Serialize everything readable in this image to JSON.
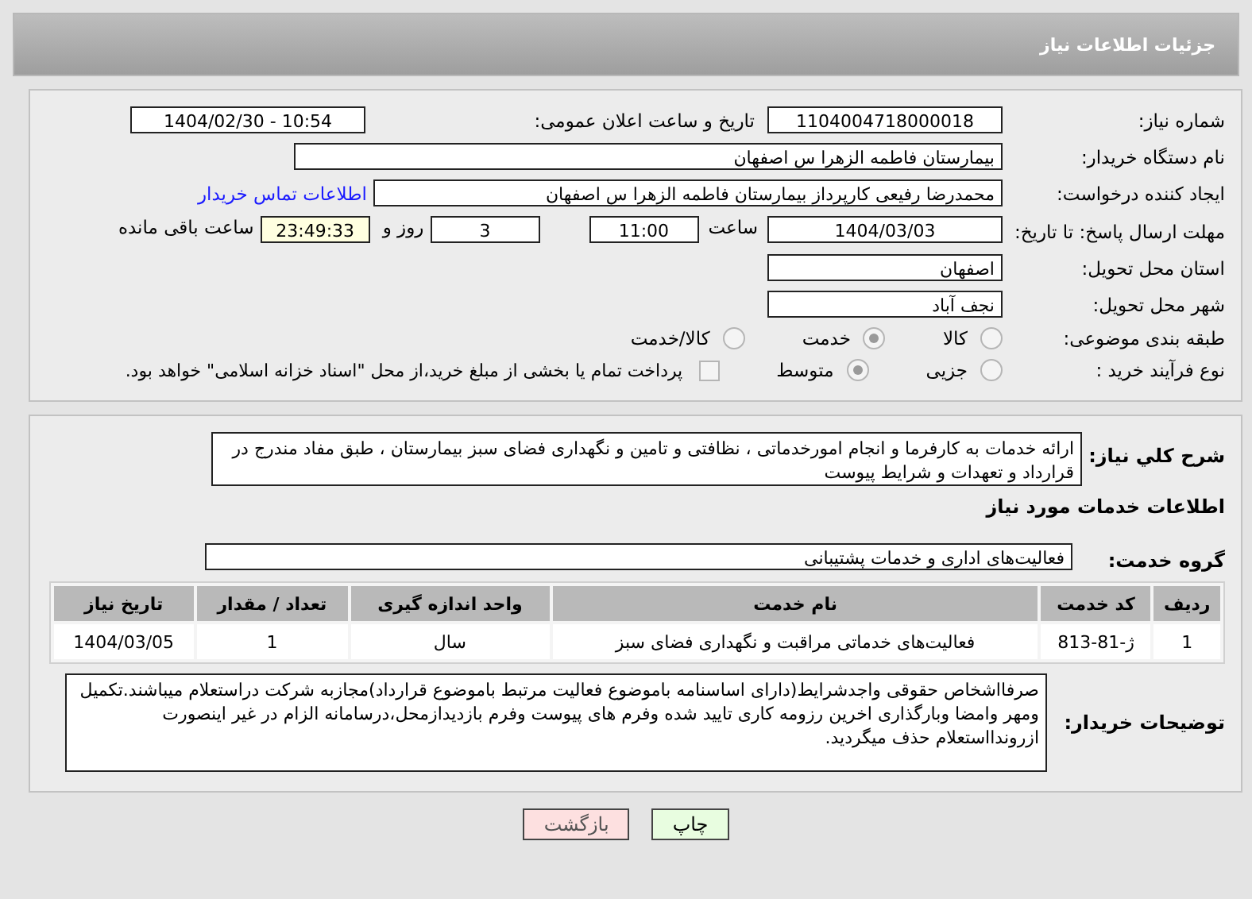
{
  "header": {
    "title": "جزئیات اطلاعات نیاز"
  },
  "need_number": {
    "label": "شماره نیاز:",
    "value": "1104004718000018"
  },
  "announce": {
    "label": "تاریخ و ساعت اعلان عمومی:",
    "value": "1404/02/30 - 10:54"
  },
  "buyer": {
    "label": "نام دستگاه خریدار:",
    "value": "بیمارستان فاطمه الزهرا س  اصفهان"
  },
  "creator": {
    "label": "ایجاد کننده درخواست:",
    "value": "محمدرضا رفیعی کارپرداز بیمارستان فاطمه الزهرا س  اصفهان",
    "link": "اطلاعات تماس خریدار"
  },
  "deadline": {
    "label": "مهلت ارسال پاسخ: تا تاریخ:",
    "date": "1404/03/03",
    "time_label": "ساعت",
    "time": "11:00",
    "days": "3",
    "days_label": "روز و",
    "remaining": "23:49:33",
    "remaining_label": "ساعت باقی مانده"
  },
  "province": {
    "label": "استان محل تحویل:",
    "value": "اصفهان"
  },
  "city": {
    "label": "شهر محل تحویل:",
    "value": "نجف آباد"
  },
  "category": {
    "label": "طبقه بندی موضوعی:",
    "options": [
      {
        "label": "کالا",
        "selected": false
      },
      {
        "label": "خدمت",
        "selected": true
      },
      {
        "label": "کالا/خدمت",
        "selected": false
      }
    ]
  },
  "process": {
    "label": "نوع فرآیند خرید :",
    "options": [
      {
        "label": "جزیی",
        "selected": false
      },
      {
        "label": "متوسط",
        "selected": true
      }
    ],
    "payment": {
      "label": "پرداخت تمام یا بخشی از مبلغ خرید،از محل \"اسناد خزانه اسلامی\" خواهد بود.",
      "checked": false
    }
  },
  "description": {
    "label": "شرح کلي نياز:",
    "value": "ارائه خدمات به کارفرما و انجام امورخدماتی ، نظافتی  و تامین و  نگهداری  فضای سبز بیمارستان ، طبق مفاد مندرج در قرارداد و تعهدات و شرایط پیوست"
  },
  "services_title": "اطلاعات خدمات مورد نياز",
  "service_group": {
    "label": "گروه خدمت:",
    "value": "فعالیت‌های اداری و خدمات پشتیبانی"
  },
  "table": {
    "columns": [
      "ردیف",
      "کد خدمت",
      "نام خدمت",
      "واحد اندازه گیری",
      "تعداد / مقدار",
      "تاریخ نیاز"
    ],
    "rows": [
      [
        "1",
        "ژ-81-813",
        "فعالیت‌های خدماتی مراقبت و نگهداری فضای سبز",
        "سال",
        "1",
        "1404/03/05"
      ]
    ]
  },
  "buyer_notes": {
    "label": "توضیحات خریدار:",
    "value": "صرفااشخاص حقوقی واجدشرایط(دارای اساسنامه باموضوع فعالیت مرتبط باموضوع قرارداد)مجازبه شرکت دراستعلام میباشند.تکمیل ومهر وامضا وبارگذاری اخرین رزومه کاری تایید شده وفرم های پیوست وفرم بازدیدازمحل،درسامانه الزام در غیر اینصورت ازروندااستعلام حذف میگردید."
  },
  "buttons": [
    {
      "label": "چاپ",
      "kind": "print"
    },
    {
      "label": "بازگشت",
      "kind": "back"
    }
  ]
}
